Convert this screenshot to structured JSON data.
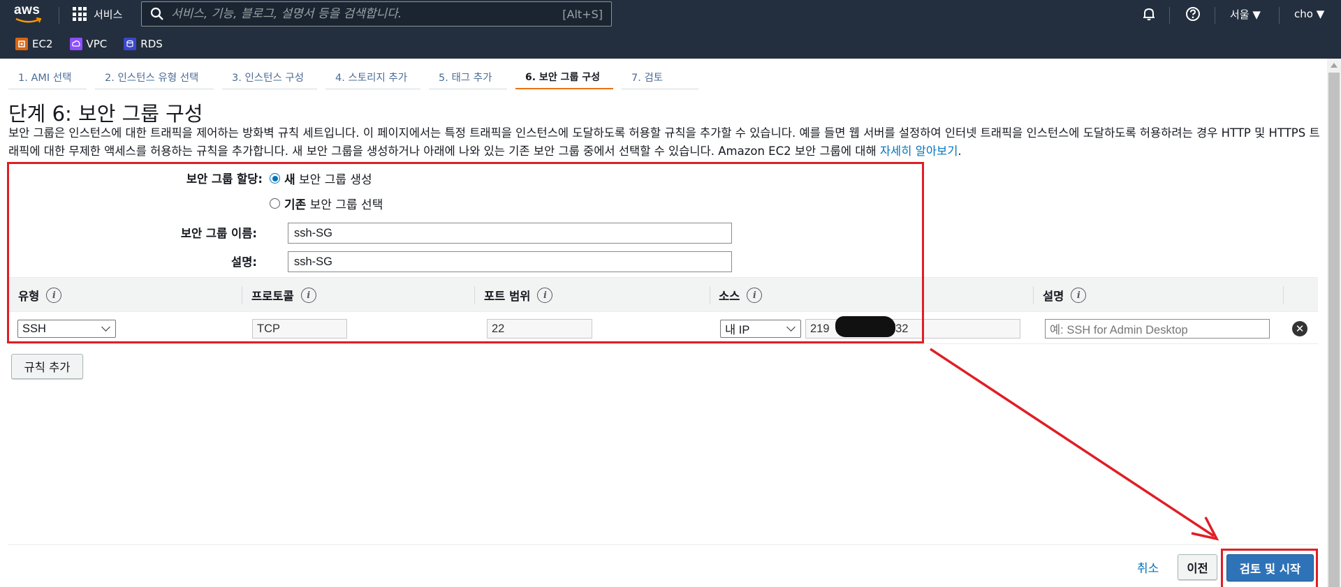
{
  "topbar": {
    "logo_text": "aws",
    "services_label": "서비스",
    "search_placeholder": "서비스, 기능, 블로그, 설명서 등을 검색합니다.",
    "search_shortcut": "[Alt+S]",
    "region_label": "서울 ▼",
    "user_label": "cho ▼",
    "background_color": "#232f3e",
    "favorites": [
      {
        "label": "EC2",
        "icon": "ec2-icon",
        "color": "#d86613"
      },
      {
        "label": "VPC",
        "icon": "vpc-icon",
        "color": "#8c4fff"
      },
      {
        "label": "RDS",
        "icon": "rds-icon",
        "color": "#3b48cc"
      }
    ]
  },
  "wizard": {
    "tabs": [
      {
        "label": "1. AMI 선택"
      },
      {
        "label": "2. 인스턴스 유형 선택"
      },
      {
        "label": "3. 인스턴스 구성"
      },
      {
        "label": "4. 스토리지 추가"
      },
      {
        "label": "5. 태그 추가"
      },
      {
        "label": "6. 보안 그룹 구성",
        "active": true
      },
      {
        "label": "7. 검토"
      }
    ],
    "accent_color": "#ec7211"
  },
  "page": {
    "title": "단계 6: 보안 그룹 구성",
    "description": "보안 그룹은 인스턴스에 대한 트래픽을 제어하는 방화벽 규칙 세트입니다. 이 페이지에서는 특정 트래픽을 인스턴스에 도달하도록 허용할 규칙을 추가할 수 있습니다. 예를 들면 웹 서버를 설정하여 인터넷 트래픽을 인스턴스에 도달하도록 허용하려는 경우 HTTP 및 HTTPS 트래픽에 대한 무제한 액세스를 허용하는 규칙을 추가합니다. 새 보안 그룹을 생성하거나 아래에 나와 있는 기존 보안 그룹 중에서 선택할 수 있습니다. Amazon EC2 보안 그룹에 대해 ",
    "learn_more": "자세히 알아보기",
    "desc_end": "."
  },
  "form": {
    "assign_label": "보안 그룹 할당:",
    "option_new_bold": "새",
    "option_new_rest": " 보안 그룹 생성",
    "option_existing_bold": "기존",
    "option_existing_rest": " 보안 그룹 선택",
    "selected_option": "new",
    "name_label": "보안 그룹 이름:",
    "name_value": "ssh-SG",
    "desc_label": "설명:",
    "desc_value": "ssh-SG"
  },
  "rules_table": {
    "columns": [
      "유형",
      "프로토콜",
      "포트 범위",
      "소스",
      "설명"
    ],
    "rows": [
      {
        "type": "SSH",
        "protocol": "TCP",
        "port_range": "22",
        "source_type": "내 IP",
        "source_prefix": "219",
        "source_suffix": "/32",
        "description_placeholder": "예: SSH for Admin Desktop"
      }
    ],
    "add_rule_label": "규칙 추가"
  },
  "footer": {
    "cancel_label": "취소",
    "previous_label": "이전",
    "review_launch_label": "검토 및 시작"
  },
  "annotation": {
    "color": "#e01e25"
  }
}
